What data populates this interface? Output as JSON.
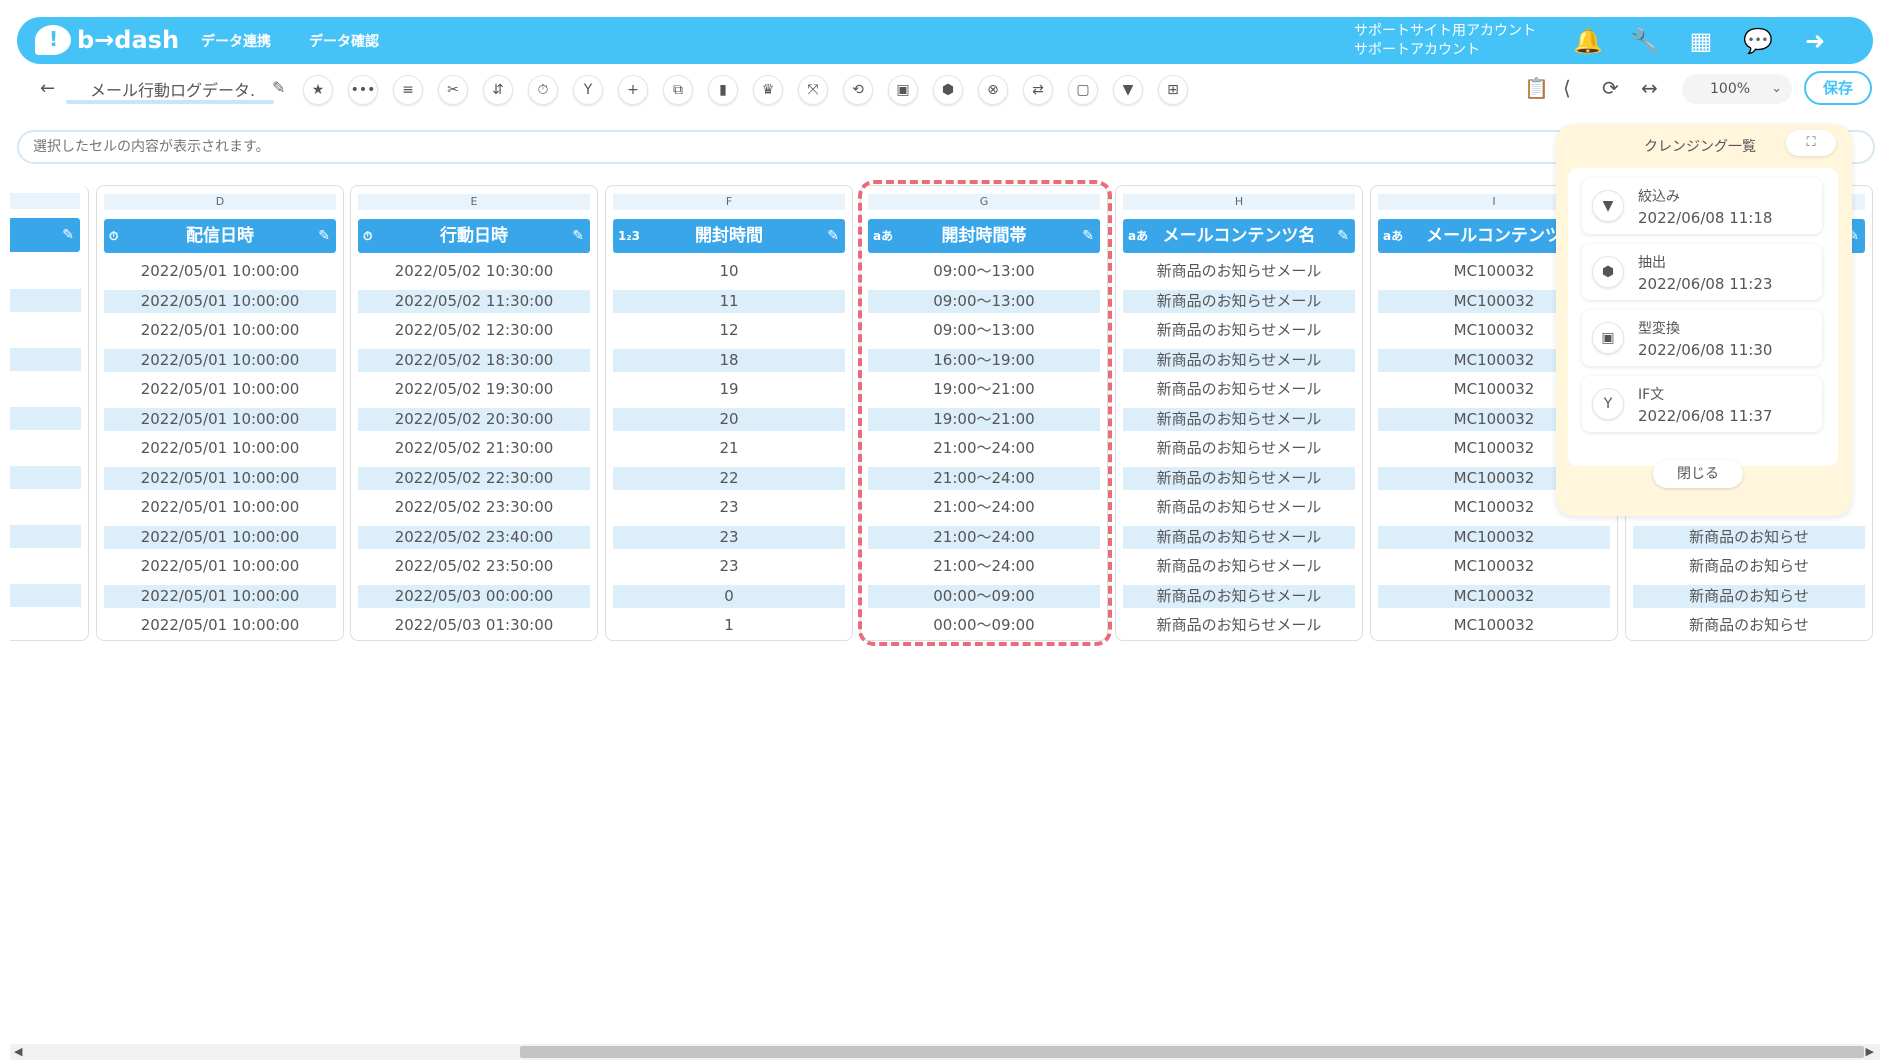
{
  "app": {
    "logo_text": "b→dash",
    "nav": [
      "データ連携",
      "データ確認"
    ]
  },
  "account": {
    "line1": "サポートサイト用アカウント",
    "line2": "サポートアカウント"
  },
  "toolbar": {
    "back_icon": "arrow-left-icon",
    "title": "メール行動ログデータ.",
    "edit_icon": "pencil-icon",
    "tools": [
      "star-icon",
      "dots-icon",
      "list-icon",
      "scissors-icon",
      "merge-icon",
      "timer-icon",
      "branch-icon",
      "plus-icon",
      "copy-icon",
      "trash-icon",
      "crown-icon",
      "expand-icon",
      "loop-icon",
      "type-convert-icon",
      "extract-icon",
      "close-circle-icon",
      "swap-icon",
      "frame-icon",
      "filter-icon",
      "grid-icon"
    ],
    "right_icons": [
      "clipboard-icon",
      "share-icon",
      "refresh-doc-icon",
      "code-icon"
    ],
    "zoom": "100%",
    "save": "保存"
  },
  "cellbar": {
    "placeholder": "選択したセルの内容が表示されます。"
  },
  "columns": [
    {
      "letter": "D",
      "header": "配信日時",
      "type": "⏱",
      "rows": [
        "2022/05/01 10:00:00",
        "2022/05/01 10:00:00",
        "2022/05/01 10:00:00",
        "2022/05/01 10:00:00",
        "2022/05/01 10:00:00",
        "2022/05/01 10:00:00",
        "2022/05/01 10:00:00",
        "2022/05/01 10:00:00",
        "2022/05/01 10:00:00",
        "2022/05/01 10:00:00",
        "2022/05/01 10:00:00",
        "2022/05/01 10:00:00",
        "2022/05/01 10:00:00"
      ]
    },
    {
      "letter": "E",
      "header": "行動日時",
      "type": "⏱",
      "rows": [
        "2022/05/02 10:30:00",
        "2022/05/02 11:30:00",
        "2022/05/02 12:30:00",
        "2022/05/02 18:30:00",
        "2022/05/02 19:30:00",
        "2022/05/02 20:30:00",
        "2022/05/02 21:30:00",
        "2022/05/02 22:30:00",
        "2022/05/02 23:30:00",
        "2022/05/02 23:40:00",
        "2022/05/02 23:50:00",
        "2022/05/03 00:00:00",
        "2022/05/03 01:30:00"
      ]
    },
    {
      "letter": "F",
      "header": "開封時間",
      "type": "1₂3",
      "rows": [
        "10",
        "11",
        "12",
        "18",
        "19",
        "20",
        "21",
        "22",
        "23",
        "23",
        "23",
        "0",
        "1"
      ]
    },
    {
      "letter": "G",
      "header": "開封時間帯",
      "type": "aあ",
      "rows": [
        "09:00～13:00",
        "09:00～13:00",
        "09:00～13:00",
        "16:00～19:00",
        "19:00～21:00",
        "19:00～21:00",
        "21:00～24:00",
        "21:00～24:00",
        "21:00～24:00",
        "21:00～24:00",
        "21:00～24:00",
        "00:00～09:00",
        "00:00～09:00"
      ]
    },
    {
      "letter": "H",
      "header": "メールコンテンツ名",
      "type": "aあ",
      "rows": [
        "新商品のお知らせメール",
        "新商品のお知らせメール",
        "新商品のお知らせメール",
        "新商品のお知らせメール",
        "新商品のお知らせメール",
        "新商品のお知らせメール",
        "新商品のお知らせメール",
        "新商品のお知らせメール",
        "新商品のお知らせメール",
        "新商品のお知らせメール",
        "新商品のお知らせメール",
        "新商品のお知らせメール",
        "新商品のお知らせメール"
      ]
    },
    {
      "letter": "I",
      "header": "メールコンテンツ",
      "type": "aあ",
      "rows": [
        "MC100032",
        "MC100032",
        "MC100032",
        "MC100032",
        "MC100032",
        "MC100032",
        "MC100032",
        "MC100032",
        "MC100032",
        "MC100032",
        "MC100032",
        "MC100032",
        "MC100032"
      ]
    },
    {
      "letter": "",
      "header": "",
      "type": "",
      "rows": [
        "",
        "",
        "",
        "",
        "",
        "",
        "",
        "",
        "",
        "新商品のお知らせ",
        "新商品のお知らせ",
        "新商品のお知らせ",
        "新商品のお知らせ"
      ]
    }
  ],
  "cleansing": {
    "title": "クレンジング一覧",
    "items": [
      {
        "icon": "filter-icon",
        "name": "絞込み",
        "time": "2022/06/08 11:18"
      },
      {
        "icon": "extract-icon",
        "name": "抽出",
        "time": "2022/06/08 11:23"
      },
      {
        "icon": "type-convert-icon",
        "name": "型変換",
        "time": "2022/06/08 11:30"
      },
      {
        "icon": "branch-icon",
        "name": "IF文",
        "time": "2022/06/08 11:37"
      }
    ],
    "close": "閉じる"
  }
}
